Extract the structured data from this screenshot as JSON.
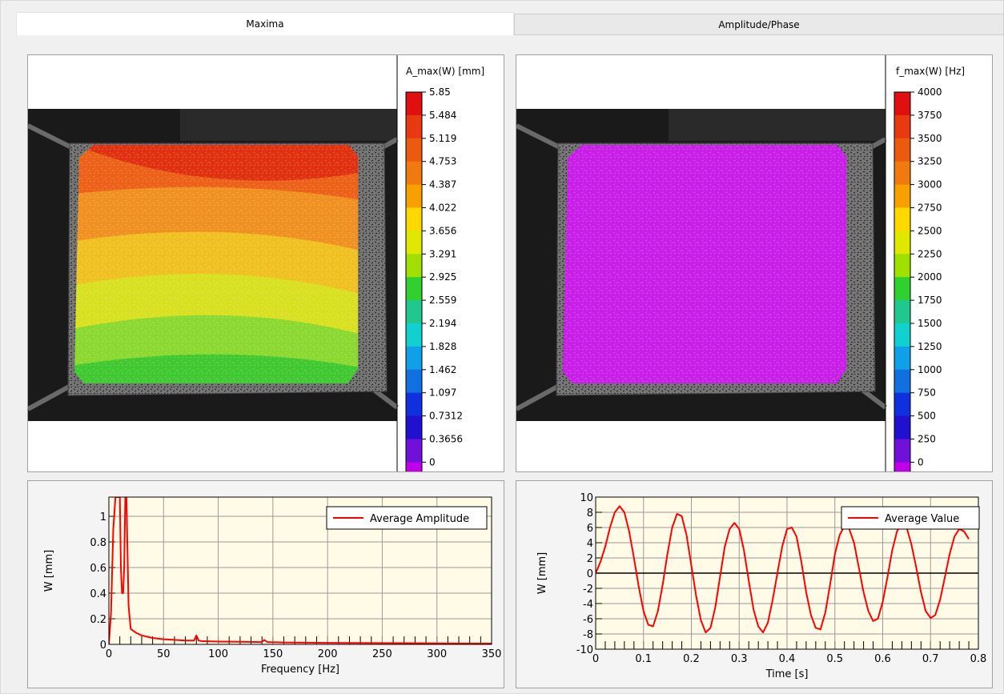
{
  "tabs": [
    {
      "label": "Maxima",
      "active": true
    },
    {
      "label": "Amplitude/Phase",
      "active": false
    }
  ],
  "map_left": {
    "colorbar_title": "A_max(W) [mm]",
    "ticks": [
      "5.85",
      "5.484",
      "5.119",
      "4.753",
      "4.387",
      "4.022",
      "3.656",
      "3.291",
      "2.925",
      "2.559",
      "2.194",
      "1.828",
      "1.462",
      "1.097",
      "0.7312",
      "0.3656",
      "0"
    ],
    "colors": [
      "#e01010",
      "#e83a10",
      "#ec5a10",
      "#f07a10",
      "#f8a000",
      "#ffd800",
      "#e0e800",
      "#a0e000",
      "#30d030",
      "#20c890",
      "#10d0d0",
      "#10a0e8",
      "#1070e0",
      "#1030e0",
      "#2010d0",
      "#7010d8",
      "#c000e8",
      "#e800ff"
    ]
  },
  "map_right": {
    "colorbar_title": "f_max(W) [Hz]",
    "ticks": [
      "4000",
      "3750",
      "3500",
      "3250",
      "3000",
      "2750",
      "2500",
      "2250",
      "2000",
      "1750",
      "1500",
      "1250",
      "1000",
      "750",
      "500",
      "250",
      "0"
    ],
    "colors": [
      "#e01010",
      "#e83a10",
      "#ec5a10",
      "#f07a10",
      "#f8a000",
      "#ffd800",
      "#e0e800",
      "#a0e000",
      "#30d030",
      "#20c890",
      "#10d0d0",
      "#10a0e8",
      "#1070e0",
      "#1030e0",
      "#2010d0",
      "#7010d8",
      "#c000e8",
      "#e800ff"
    ]
  },
  "chart_data": [
    {
      "type": "line",
      "xlabel": "Frequency [Hz]",
      "ylabel": "W [mm]",
      "xlim": [
        0,
        350
      ],
      "ylim": [
        0,
        1.15
      ],
      "xticks": [
        0,
        50,
        100,
        150,
        200,
        250,
        300,
        350
      ],
      "yticks": [
        0,
        0.2,
        0.4,
        0.6,
        0.8,
        1
      ],
      "grid": true,
      "legend_position": "top-right",
      "series": [
        {
          "name": "Average Amplitude",
          "color": "#ff0000",
          "x": [
            0,
            2,
            4,
            6,
            8,
            10,
            11,
            12,
            13,
            14,
            15,
            16,
            18,
            20,
            25,
            30,
            40,
            50,
            60,
            70,
            78,
            80,
            82,
            85,
            100,
            120,
            140,
            142,
            145,
            160,
            200,
            250,
            300,
            350
          ],
          "y": [
            0,
            0.25,
            0.9,
            1.15,
            1.15,
            1.15,
            0.6,
            0.4,
            0.4,
            0.6,
            1.15,
            1.15,
            0.3,
            0.12,
            0.09,
            0.07,
            0.05,
            0.04,
            0.035,
            0.03,
            0.03,
            0.07,
            0.03,
            0.025,
            0.022,
            0.02,
            0.018,
            0.035,
            0.018,
            0.015,
            0.012,
            0.01,
            0.008,
            0.006
          ]
        }
      ]
    },
    {
      "type": "line",
      "xlabel": "Time [s]",
      "ylabel": "W [mm]",
      "xlim": [
        0,
        0.8
      ],
      "ylim": [
        -10,
        10
      ],
      "xticks": [
        0,
        0.1,
        0.2,
        0.3,
        0.4,
        0.5,
        0.6,
        0.7,
        0.8
      ],
      "yticks": [
        -10,
        -8,
        -6,
        -4,
        -2,
        0,
        2,
        4,
        6,
        8,
        10
      ],
      "grid": true,
      "legend_position": "top-right",
      "series": [
        {
          "name": "Average Value",
          "color": "#ff0000",
          "x": [
            0,
            0.01,
            0.02,
            0.03,
            0.04,
            0.05,
            0.06,
            0.07,
            0.08,
            0.09,
            0.1,
            0.11,
            0.12,
            0.13,
            0.14,
            0.15,
            0.16,
            0.17,
            0.18,
            0.19,
            0.2,
            0.21,
            0.22,
            0.23,
            0.24,
            0.25,
            0.26,
            0.27,
            0.28,
            0.29,
            0.3,
            0.31,
            0.32,
            0.33,
            0.34,
            0.35,
            0.36,
            0.37,
            0.38,
            0.39,
            0.4,
            0.41,
            0.42,
            0.43,
            0.44,
            0.45,
            0.46,
            0.47,
            0.48,
            0.49,
            0.5,
            0.51,
            0.52,
            0.53,
            0.54,
            0.55,
            0.56,
            0.57,
            0.58,
            0.59,
            0.6,
            0.61,
            0.62,
            0.63,
            0.64,
            0.65,
            0.66,
            0.67,
            0.68,
            0.69,
            0.7,
            0.71,
            0.72,
            0.73,
            0.74,
            0.75,
            0.76,
            0.77,
            0.78
          ],
          "y": [
            0,
            1.5,
            3.5,
            6.0,
            8.0,
            8.8,
            8.0,
            5.5,
            2.0,
            -1.8,
            -5.0,
            -6.8,
            -7.0,
            -5.0,
            -1.5,
            2.5,
            6.0,
            7.8,
            7.5,
            5.0,
            1.0,
            -3.0,
            -6.2,
            -7.8,
            -7.2,
            -4.5,
            -0.5,
            3.5,
            5.8,
            6.6,
            5.8,
            3.0,
            -1.0,
            -4.8,
            -7.0,
            -7.8,
            -6.5,
            -3.5,
            0.0,
            3.5,
            5.8,
            6.0,
            4.8,
            1.5,
            -2.5,
            -5.5,
            -7.2,
            -7.4,
            -5.2,
            -1.5,
            2.5,
            5.0,
            6.2,
            5.8,
            4.0,
            0.8,
            -2.5,
            -5.0,
            -6.3,
            -6.0,
            -3.8,
            -0.5,
            3.0,
            5.5,
            6.6,
            6.0,
            3.8,
            0.8,
            -2.5,
            -5.0,
            -5.9,
            -5.5,
            -3.5,
            -0.5,
            2.5,
            4.8,
            5.8,
            5.5,
            4.5
          ]
        }
      ]
    }
  ]
}
